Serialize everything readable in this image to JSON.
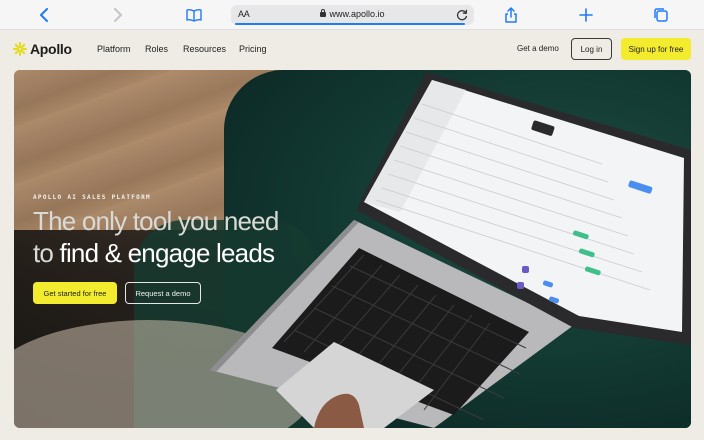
{
  "browser": {
    "address_text_size": "AA",
    "url": "www.apollo.io",
    "icons": [
      "chevron-left-icon",
      "chevron-right-icon",
      "book-icon",
      "lock-icon",
      "reload-icon",
      "share-icon",
      "plus-icon",
      "tabs-icon"
    ]
  },
  "site": {
    "brand": "Apollo",
    "nav": [
      "Platform",
      "Roles",
      "Resources",
      "Pricing"
    ],
    "get_demo": "Get a demo",
    "login": "Log in",
    "signup": "Sign up for free"
  },
  "hero": {
    "kicker": "APOLLO AI SALES PLATFORM",
    "title_line1": "The only tool you need",
    "title_line2_prefix": "to",
    "title_line2_emphasis": "find & engage leads",
    "cta_primary": "Get started for free",
    "cta_secondary": "Request a demo"
  },
  "colors": {
    "accent_yellow": "#f3ec2e",
    "page_bg": "#efece6",
    "text_dark": "#1d1d1b"
  }
}
